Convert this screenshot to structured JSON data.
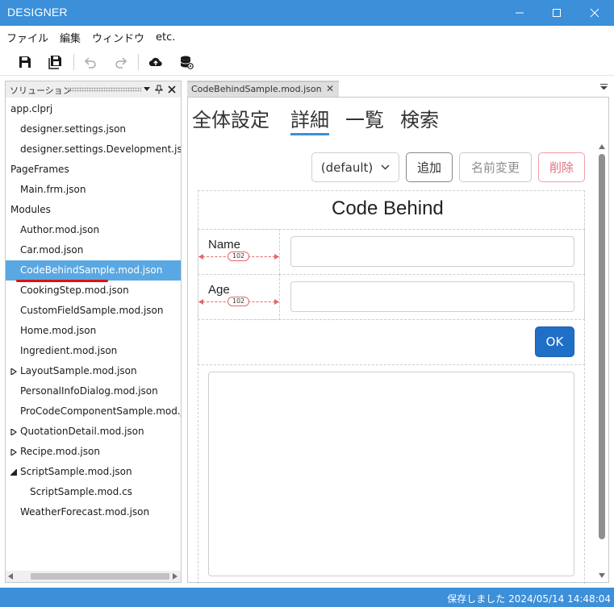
{
  "app": {
    "title": "DESIGNER"
  },
  "menu": [
    "ファイル",
    "編集",
    "ウィンドウ",
    "etc."
  ],
  "toolbar": {
    "icons": [
      "save-icon",
      "save-all-icon",
      "undo-icon",
      "redo-icon",
      "upload-cloud-icon",
      "database-icon"
    ]
  },
  "solution": {
    "title": "ソリューション",
    "items": [
      {
        "label": "app.clprj",
        "depth": 0
      },
      {
        "label": "designer.settings.json",
        "depth": 1
      },
      {
        "label": "designer.settings.Development.json",
        "depth": 1
      },
      {
        "label": "PageFrames",
        "depth": 0
      },
      {
        "label": "Main.frm.json",
        "depth": 1
      },
      {
        "label": "Modules",
        "depth": 0
      },
      {
        "label": "Author.mod.json",
        "depth": 1
      },
      {
        "label": "Car.mod.json",
        "depth": 1
      },
      {
        "label": "CodeBehindSample.mod.json",
        "depth": 1,
        "selected": true
      },
      {
        "label": "CookingStep.mod.json",
        "depth": 1
      },
      {
        "label": "CustomFieldSample.mod.json",
        "depth": 1
      },
      {
        "label": "Home.mod.json",
        "depth": 1
      },
      {
        "label": "Ingredient.mod.json",
        "depth": 1
      },
      {
        "label": "LayoutSample.mod.json",
        "depth": 1,
        "toggle": "collapsed"
      },
      {
        "label": "PersonalInfoDialog.mod.json",
        "depth": 1
      },
      {
        "label": "ProCodeComponentSample.mod.json",
        "depth": 1
      },
      {
        "label": "QuotationDetail.mod.json",
        "depth": 1,
        "toggle": "collapsed"
      },
      {
        "label": "Recipe.mod.json",
        "depth": 1,
        "toggle": "collapsed"
      },
      {
        "label": "ScriptSample.mod.json",
        "depth": 1,
        "toggle": "expanded"
      },
      {
        "label": "ScriptSample.mod.cs",
        "depth": 2
      },
      {
        "label": "WeatherForecast.mod.json",
        "depth": 1
      }
    ]
  },
  "document": {
    "tab_label": "CodeBehindSample.mod.json",
    "view_tabs": [
      "全体設定",
      "詳細",
      "一覧",
      "検索"
    ],
    "active_view_tab": "詳細",
    "layout_select": "(default)",
    "buttons": {
      "add": "追加",
      "rename": "名前変更",
      "delete": "削除"
    },
    "form": {
      "title": "Code Behind",
      "fields": [
        {
          "label": "Name",
          "width_label": "102",
          "value": ""
        },
        {
          "label": "Age",
          "width_label": "102",
          "value": ""
        }
      ],
      "ok_label": "OK",
      "memo_value": ""
    }
  },
  "status": {
    "text": "保存しました 2024/05/14 14:48:04"
  },
  "colors": {
    "accent": "#3c8fd9",
    "selection": "#5aa8e3",
    "primary_button": "#1f6fc7",
    "danger": "#e07080"
  }
}
